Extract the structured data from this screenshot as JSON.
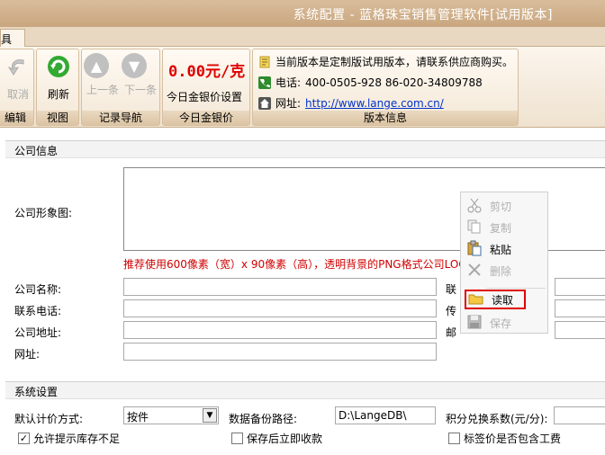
{
  "window": {
    "title": "系统配置 - 蓝格珠宝销售管理软件[试用版本]"
  },
  "tabs": [
    {
      "label": "具"
    }
  ],
  "ribbon": {
    "edit": {
      "undo_label": "取消",
      "group_label": "编辑"
    },
    "view": {
      "refresh_label": "刷新",
      "group_label": "视图"
    },
    "nav": {
      "prev_label": "上一条",
      "next_label": "下一条",
      "group_label": "记录导航"
    },
    "gold": {
      "price": "0.00元/克",
      "set_label": "今日金银价设置",
      "group_label": "今日金银价"
    },
    "version": {
      "notice": "当前版本是定制版试用版本，请联系供应商购买。",
      "phone_label": "电话:",
      "phone_value": "400-0505-928  86-020-34809788",
      "url_label": "网址:",
      "url_value": "http://www.lange.com.cn/",
      "group_label": "版本信息"
    }
  },
  "company": {
    "section_title": "公司信息",
    "logo_label": "公司形象图:",
    "logo_hint": "推荐使用600像素（宽）x 90像素（高），透明背景的PNG格式公司LOGO",
    "name_label": "公司名称:",
    "phone_label": "联系电话:",
    "address_label": "公司地址:",
    "website_label": "网址:",
    "contact_label": "联",
    "fax_label": "传",
    "email_label": "邮"
  },
  "context_menu": {
    "items": [
      {
        "label": "剪切",
        "icon": "scissors-icon",
        "enabled": false
      },
      {
        "label": "复制",
        "icon": "copy-icon",
        "enabled": false
      },
      {
        "label": "粘贴",
        "icon": "paste-icon",
        "enabled": true
      },
      {
        "label": "删除",
        "icon": "delete-x-icon",
        "enabled": false
      },
      {
        "label": "读取",
        "icon": "folder-open-icon",
        "enabled": true,
        "highlighted": true
      },
      {
        "label": "保存",
        "icon": "save-disk-icon",
        "enabled": false
      }
    ]
  },
  "system": {
    "section_title": "系统设置",
    "pricing_label": "默认计价方式:",
    "pricing_value": "按件",
    "backup_label": "数据备份路径:",
    "backup_value": "D:\\LangeDB\\",
    "points_label": "积分兑换系数(元/分):",
    "points_value": "",
    "allow_stock_label": "允许提示库存不足",
    "allow_stock_checked": true,
    "collect_after_save_label": "保存后立即收款",
    "collect_after_save_checked": false,
    "tag_price_label": "标签价是否包含工费",
    "tag_price_checked": false
  },
  "colors": {
    "accent_red": "#e00000",
    "title_bar": "#c9a67f",
    "link_blue": "#0033cc"
  }
}
